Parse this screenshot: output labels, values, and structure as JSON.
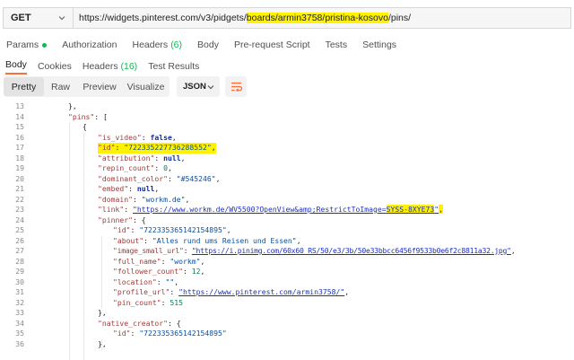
{
  "request": {
    "method": "GET",
    "url_before": "https://widgets.pinterest.com/v3/pidgets/",
    "url_highlight": "boards/armin3758/pristina-kosovo",
    "url_after": "/pins/"
  },
  "request_tabs": {
    "params": "Params",
    "authorization": "Authorization",
    "headers": "Headers",
    "headers_count": "(6)",
    "body": "Body",
    "prerequest": "Pre-request Script",
    "tests": "Tests",
    "settings": "Settings"
  },
  "response_tabs": {
    "body": "Body",
    "cookies": "Cookies",
    "headers": "Headers",
    "headers_count": "(16)",
    "test_results": "Test Results"
  },
  "toolbar": {
    "pretty": "Pretty",
    "raw": "Raw",
    "preview": "Preview",
    "visualize": "Visualize",
    "format": "JSON"
  },
  "colors": {
    "accent": "#ff6c37",
    "highlight": "#fff200",
    "success": "#0cbb52"
  },
  "code": {
    "l13": {
      "num": "13",
      "close": "},"
    },
    "l14": {
      "num": "14",
      "key": "\"pins\"",
      "punct": ": ["
    },
    "l15": {
      "num": "15",
      "open": "{"
    },
    "l16": {
      "num": "16",
      "key": "\"is_video\"",
      "sep": ": ",
      "val": "false",
      "end": ","
    },
    "l17": {
      "num": "17",
      "key": "\"id\"",
      "sep": ": ",
      "val": "\"722335227736288552\"",
      "end": ","
    },
    "l18": {
      "num": "18",
      "key": "\"attribution\"",
      "sep": ": ",
      "val": "null",
      "end": ","
    },
    "l19": {
      "num": "19",
      "key": "\"repin_count\"",
      "sep": ": ",
      "val": "0",
      "end": ","
    },
    "l20": {
      "num": "20",
      "key": "\"dominant_color\"",
      "sep": ": ",
      "val": "\"#545246\"",
      "end": ","
    },
    "l21": {
      "num": "21",
      "key": "\"embed\"",
      "sep": ": ",
      "val": "null",
      "end": ","
    },
    "l22": {
      "num": "22",
      "key": "\"domain\"",
      "sep": ": ",
      "val": "\"workm.de\"",
      "end": ","
    },
    "l23": {
      "num": "23",
      "key": "\"link\"",
      "sep": ": ",
      "val": "\"https://www.workm.de/WV5500?OpenView&amp;RestrictToImage=",
      "val_hl": "SYSS-8XYE73",
      "val_end": "\"",
      "end": ","
    },
    "l24": {
      "num": "24",
      "key": "\"pinner\"",
      "punct": ": {"
    },
    "l25": {
      "num": "25",
      "key": "\"id\"",
      "sep": ": ",
      "val": "\"722335365142154895\"",
      "end": ","
    },
    "l26": {
      "num": "26",
      "key": "\"about\"",
      "sep": ": ",
      "val": "\"Alles rund ums Reisen und Essen\"",
      "end": ","
    },
    "l27": {
      "num": "27",
      "key": "\"image_small_url\"",
      "sep": ": ",
      "val": "\"https://i.pinimg.com/60x60_RS/50/e3/3b/50e33bbcc6456f9533b0e6f2c8811a32.jpg\"",
      "end": ","
    },
    "l28": {
      "num": "28",
      "key": "\"full_name\"",
      "sep": ": ",
      "val": "\"workm\"",
      "end": ","
    },
    "l29": {
      "num": "29",
      "key": "\"follower_count\"",
      "sep": ": ",
      "val": "12",
      "end": ","
    },
    "l30": {
      "num": "30",
      "key": "\"location\"",
      "sep": ": ",
      "val": "\"\"",
      "end": ","
    },
    "l31": {
      "num": "31",
      "key": "\"profile_url\"",
      "sep": ": ",
      "val": "\"https://www.pinterest.com/armin3758/\"",
      "end": ","
    },
    "l32": {
      "num": "32",
      "key": "\"pin_count\"",
      "sep": ": ",
      "val": "515"
    },
    "l33": {
      "num": "33",
      "close": "},"
    },
    "l34": {
      "num": "34",
      "key": "\"native_creator\"",
      "punct": ": {"
    },
    "l35": {
      "num": "35",
      "key": "\"id\"",
      "sep": ": ",
      "val": "\"722335365142154895\""
    },
    "l36": {
      "num": "36",
      "close": "},"
    }
  }
}
